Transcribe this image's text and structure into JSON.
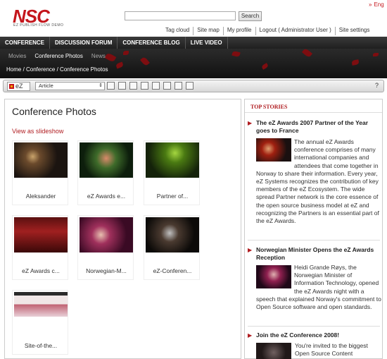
{
  "header": {
    "logo": "NSC",
    "logo_subtitle": "EZ PUBLISH FLOW DEMO",
    "lang": "Eng",
    "search_placeholder": "",
    "search_button": "Search",
    "links": [
      "Tag cloud",
      "Site map",
      "My profile",
      "Logout ( Administrator User )",
      "Site settings"
    ]
  },
  "main_nav": [
    "CONFERENCE",
    "DISCUSSION FORUM",
    "CONFERENCE BLOG",
    "LIVE VIDEO"
  ],
  "sub_nav": [
    {
      "label": "Movies",
      "active": false
    },
    {
      "label": "Conference Photos",
      "active": true
    },
    {
      "label": "News",
      "active": false
    }
  ],
  "breadcrumb": "Home / Conference / Conference Photos",
  "toolbar": {
    "brand": "eZ",
    "class_select": "Article",
    "help": "?"
  },
  "content": {
    "title": "Conference Photos",
    "slideshow_link": "View as slideshow",
    "photos": [
      {
        "caption": "Aleksander"
      },
      {
        "caption": "eZ Awards e..."
      },
      {
        "caption": "Partner of..."
      },
      {
        "caption": "eZ Awards c..."
      },
      {
        "caption": "Norwegian-M..."
      },
      {
        "caption": "eZ-Conferen..."
      },
      {
        "caption": "Site-of-the..."
      }
    ]
  },
  "sidebar": {
    "heading": "TOP STORIES",
    "stories": [
      {
        "title": "The eZ Awards 2007 Partner of the Year goes to France",
        "text": "The annual eZ Awards conference comprises of many international companies and attendees that come together in Norway to share their information. Every year, eZ Systems recognizes the contribution of key members of the eZ Ecosystem. The wide spread Partner network is the core essence of the open source business model at eZ and recognizing the Partners is an essential part of the eZ Awards."
      },
      {
        "title": "Norwegian Minister Opens the eZ Awards Reception",
        "text": "Heidi Grande Røys, the Norwegian Minister of Information Technology, opened the eZ Awards night with a speech that explained Norway's commitment to Open Source software and open standards."
      },
      {
        "title": "Join the eZ Conference 2008!",
        "text": "You're invited to the biggest Open Source Content"
      }
    ]
  },
  "colors": {
    "accent": "#c4161c",
    "link": "#b01c20",
    "nav_bg": "#2a2a2a"
  }
}
